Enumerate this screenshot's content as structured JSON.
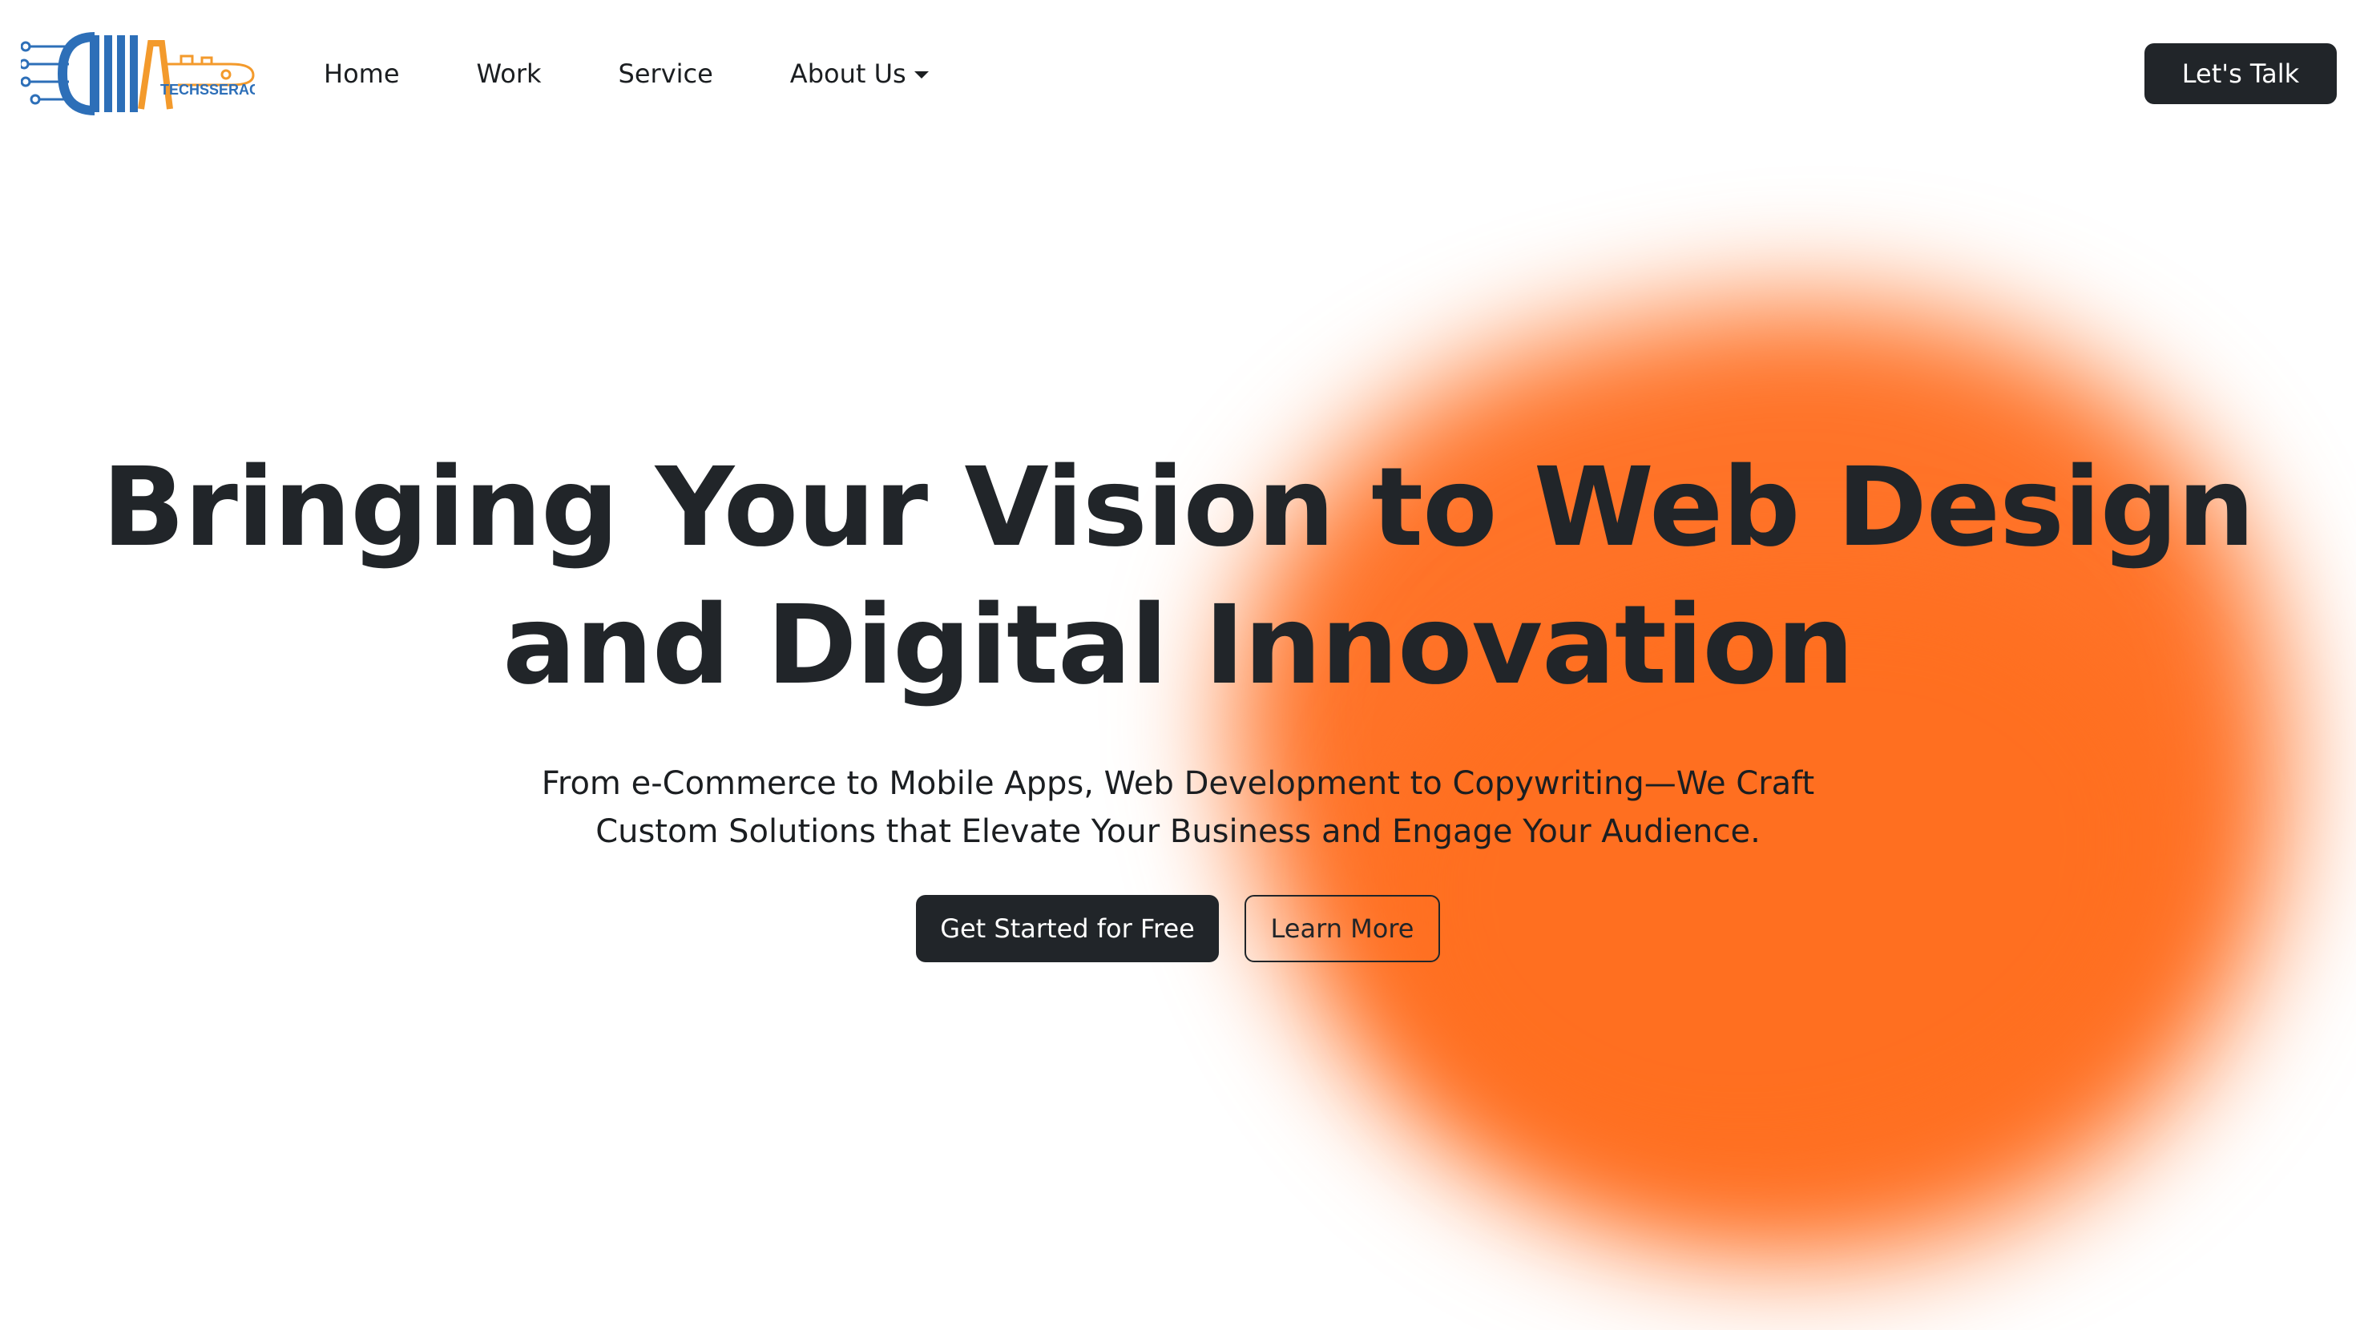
{
  "brand": {
    "logo_text": "TECHSSERACT",
    "logo_mark": "CMA",
    "colors": {
      "blue": "#2d6fb8",
      "orange": "#f39a2c"
    }
  },
  "nav": {
    "items": [
      {
        "label": "Home"
      },
      {
        "label": "Work"
      },
      {
        "label": "Service"
      },
      {
        "label": "About Us",
        "has_dropdown": true
      }
    ],
    "cta_label": "Let's Talk"
  },
  "hero": {
    "headline_line1": "Bringing Your Vision to Web Design",
    "headline_line2": "and Digital Innovation",
    "subtext_line1": "From e-Commerce to Mobile Apps, Web Development to Copywriting—We Craft",
    "subtext_line2": "Custom Solutions that Elevate Your Business and Engage Your Audience.",
    "primary_button": "Get Started for Free",
    "secondary_button": "Learn More"
  },
  "theme": {
    "dark": "#212529",
    "accent": "#ff7328",
    "background": "#ffffff"
  }
}
